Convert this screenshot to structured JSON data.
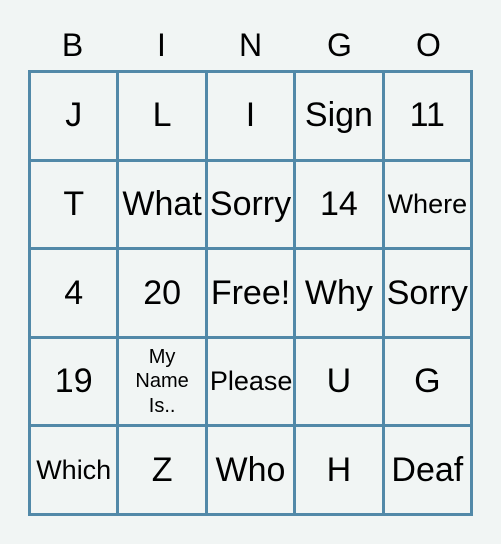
{
  "card": {
    "type": "bingo-card",
    "columns": [
      "B",
      "I",
      "N",
      "G",
      "O"
    ],
    "background_color": "#f1f5f4",
    "border_color": "#5289a8",
    "text_color": "#000000",
    "free_space": "Free!",
    "rows": [
      [
        {
          "text": "J",
          "size": "lg"
        },
        {
          "text": "L",
          "size": "lg"
        },
        {
          "text": "I",
          "size": "lg"
        },
        {
          "text": "Sign",
          "size": "lg"
        },
        {
          "text": "11",
          "size": "lg"
        }
      ],
      [
        {
          "text": "T",
          "size": "lg"
        },
        {
          "text": "What",
          "size": "lg"
        },
        {
          "text": "Sorry",
          "size": "lg"
        },
        {
          "text": "14",
          "size": "lg"
        },
        {
          "text": "Where",
          "size": "md"
        }
      ],
      [
        {
          "text": "4",
          "size": "lg"
        },
        {
          "text": "20",
          "size": "lg"
        },
        {
          "text": "Free!",
          "size": "lg"
        },
        {
          "text": "Why",
          "size": "lg"
        },
        {
          "text": "Sorry",
          "size": "lg"
        }
      ],
      [
        {
          "text": "19",
          "size": "lg"
        },
        {
          "text": "My\nName\nIs..",
          "size": "sm"
        },
        {
          "text": "Please",
          "size": "md"
        },
        {
          "text": "U",
          "size": "lg"
        },
        {
          "text": "G",
          "size": "lg"
        }
      ],
      [
        {
          "text": "Which",
          "size": "md"
        },
        {
          "text": "Z",
          "size": "lg"
        },
        {
          "text": "Who",
          "size": "lg"
        },
        {
          "text": "H",
          "size": "lg"
        },
        {
          "text": "Deaf",
          "size": "lg"
        }
      ]
    ]
  }
}
